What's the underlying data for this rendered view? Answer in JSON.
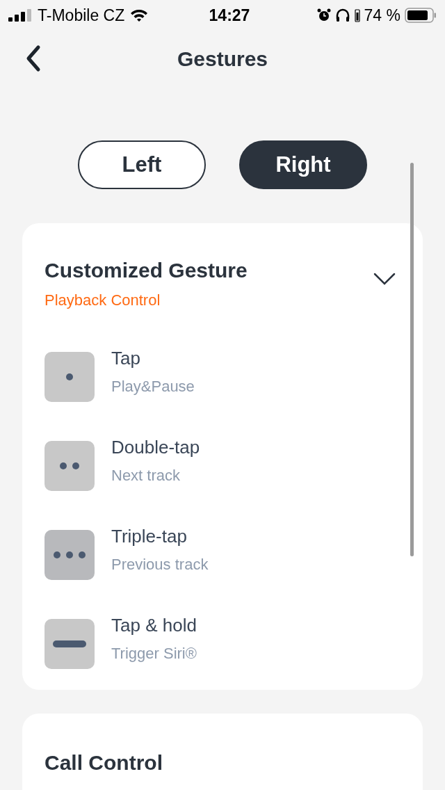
{
  "status_bar": {
    "carrier": "T-Mobile CZ",
    "time": "14:27",
    "battery": "74 %"
  },
  "header": {
    "title": "Gestures"
  },
  "tabs": [
    {
      "label": "Left",
      "selected": false
    },
    {
      "label": "Right",
      "selected": true
    }
  ],
  "gesture_card": {
    "title": "Customized Gesture",
    "subtitle": "Playback Control",
    "expanded": true,
    "items": [
      {
        "kind": "single",
        "label": "Tap",
        "action": "Play&Pause",
        "selected": false
      },
      {
        "kind": "double",
        "label": "Double-tap",
        "action": "Next track",
        "selected": false
      },
      {
        "kind": "triple",
        "label": "Triple-tap",
        "action": "Previous track",
        "selected": true
      },
      {
        "kind": "hold",
        "label": "Tap & hold",
        "action": "Trigger Siri®",
        "selected": false
      }
    ]
  },
  "call_card": {
    "title": "Call Control"
  }
}
